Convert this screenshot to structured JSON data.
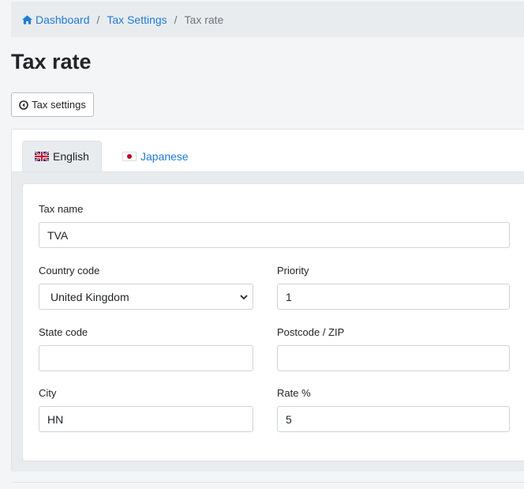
{
  "breadcrumb": {
    "items": [
      {
        "label": "Dashboard",
        "icon": "home-icon"
      },
      {
        "label": "Tax Settings"
      },
      {
        "label": "Tax rate"
      }
    ],
    "separator": "/"
  },
  "page": {
    "title": "Tax rate",
    "back_button_label": "Tax settings"
  },
  "tabs": [
    {
      "label": "English",
      "flag": "uk-flag-icon",
      "active": true
    },
    {
      "label": "Japanese",
      "flag": "japan-flag-icon",
      "active": false
    }
  ],
  "form": {
    "tax_name": {
      "label": "Tax name",
      "value": "TVA"
    },
    "country_code": {
      "label": "Country code",
      "value": "United Kingdom"
    },
    "priority": {
      "label": "Priority",
      "value": "1"
    },
    "state_code": {
      "label": "State code",
      "value": ""
    },
    "postcode": {
      "label": "Postcode / ZIP",
      "value": ""
    },
    "city": {
      "label": "City",
      "value": "HN"
    },
    "rate": {
      "label": "Rate %",
      "value": "5"
    }
  },
  "colors": {
    "link": "#1e7cd4",
    "background": "#f4f5f7",
    "breadcrumb_bg": "#e9ecef"
  }
}
